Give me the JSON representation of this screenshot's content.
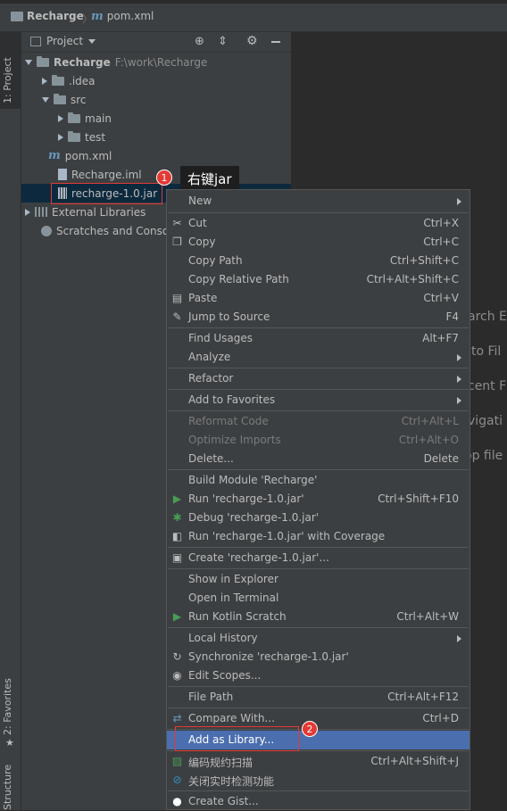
{
  "breadcrumb": {
    "project": "Recharge",
    "file": "pom.xml"
  },
  "toolstrip": {
    "project": "1: Project",
    "favorites": "2: Favorites",
    "structure": "Structure"
  },
  "panel": {
    "title": "Project"
  },
  "tree": {
    "root": {
      "name": "Recharge",
      "path": "F:\\work\\Recharge"
    },
    "idea": ".idea",
    "src": "src",
    "main": "main",
    "test": "test",
    "pom": "pom.xml",
    "iml": "Recharge.iml",
    "jar": "recharge-1.0.jar",
    "external": "External Libraries",
    "scratches": "Scratches and Consoles"
  },
  "editor_hints": [
    "arch E",
    "to Fil",
    "cent F",
    "vigati",
    "op file"
  ],
  "annotations": {
    "step1": "1",
    "step2": "2",
    "callout": "右键jar"
  },
  "menu": {
    "new": "New",
    "cut": "Cut",
    "cut_sc": "Ctrl+X",
    "copy": "Copy",
    "copy_sc": "Ctrl+C",
    "copy_path": "Copy Path",
    "copy_path_sc": "Ctrl+Shift+C",
    "copy_rel": "Copy Relative Path",
    "copy_rel_sc": "Ctrl+Alt+Shift+C",
    "paste": "Paste",
    "paste_sc": "Ctrl+V",
    "jump": "Jump to Source",
    "jump_sc": "F4",
    "find": "Find Usages",
    "find_sc": "Alt+F7",
    "analyze": "Analyze",
    "refactor": "Refactor",
    "favorites": "Add to Favorites",
    "reformat": "Reformat Code",
    "reformat_sc": "Ctrl+Alt+L",
    "optimize": "Optimize Imports",
    "optimize_sc": "Ctrl+Alt+O",
    "delete": "Delete...",
    "delete_sc": "Delete",
    "build": "Build Module 'Recharge'",
    "run": "Run 'recharge-1.0.jar'",
    "run_sc": "Ctrl+Shift+F10",
    "debug": "Debug 'recharge-1.0.jar'",
    "coverage": "Run 'recharge-1.0.jar' with Coverage",
    "create": "Create 'recharge-1.0.jar'...",
    "explorer": "Show in Explorer",
    "terminal": "Open in Terminal",
    "kotlin": "Run Kotlin Scratch",
    "kotlin_sc": "Ctrl+Alt+W",
    "history": "Local History",
    "sync": "Synchronize 'recharge-1.0.jar'",
    "scopes": "Edit Scopes...",
    "filepath": "File Path",
    "filepath_sc": "Ctrl+Alt+F12",
    "compare": "Compare With...",
    "compare_sc": "Ctrl+D",
    "addlib": "Add as Library...",
    "scan": "编码规约扫描",
    "scan_sc": "Ctrl+Alt+Shift+J",
    "realtime": "关闭实时检测功能",
    "gist": "Create Gist..."
  },
  "colors": {
    "selection": "#4b6eaf",
    "annotation": "#e53935",
    "panel": "#3c3f41",
    "editor": "#2b2b2b"
  }
}
